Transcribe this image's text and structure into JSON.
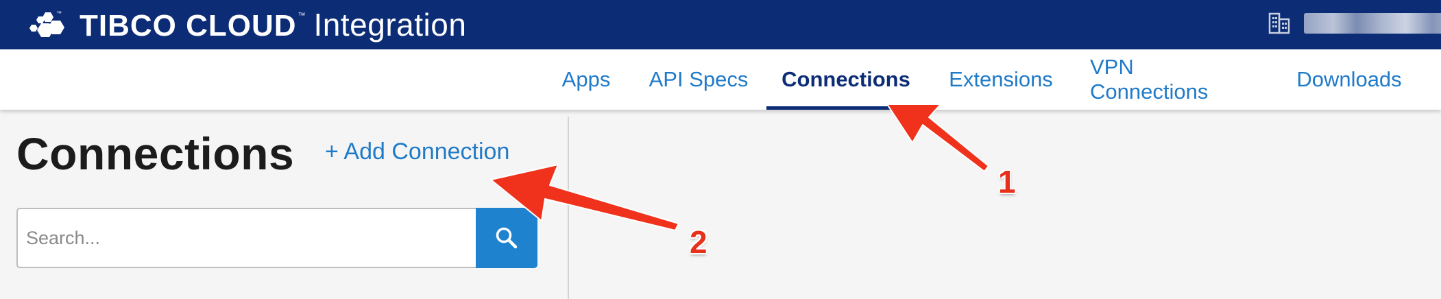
{
  "brand": {
    "name": "TIBCO CLOUD",
    "tm_logo": "™",
    "tm_name": "™",
    "product": "Integration"
  },
  "org": {
    "icon": "building-icon",
    "name_obscured": true
  },
  "nav": {
    "tabs": [
      {
        "label": "Apps",
        "active": false
      },
      {
        "label": "API Specs",
        "active": false
      },
      {
        "label": "Connections",
        "active": true
      },
      {
        "label": "Extensions",
        "active": false
      },
      {
        "label": "VPN Connections",
        "active": false
      },
      {
        "label": "Downloads",
        "active": false
      }
    ]
  },
  "left_panel": {
    "title": "Connections",
    "add_link": "+ Add Connection",
    "search": {
      "placeholder": "Search...",
      "value": "",
      "button_icon": "search-icon"
    }
  },
  "annotations": [
    {
      "number": "1",
      "target": "Connections tab"
    },
    {
      "number": "2",
      "target": "+ Add Connection"
    }
  ],
  "colors": {
    "brand_bar": "#0c2d76",
    "link_blue": "#1f7ac8",
    "active_tab": "#0c2d76",
    "search_button": "#1f82ce",
    "annotation_red": "#e8311c"
  }
}
